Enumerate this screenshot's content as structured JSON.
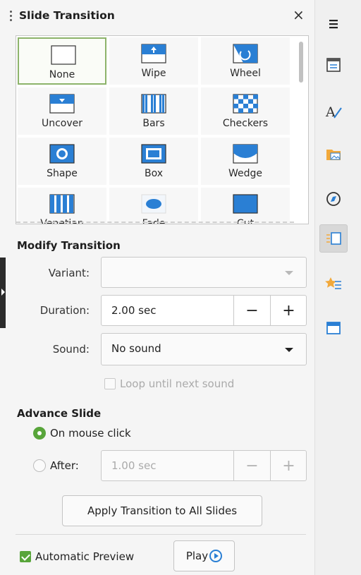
{
  "panel": {
    "title": "Slide Transition",
    "close_label": "×"
  },
  "transitions": [
    {
      "label": "None",
      "icon": "none-icon"
    },
    {
      "label": "Wipe",
      "icon": "wipe-icon"
    },
    {
      "label": "Wheel",
      "icon": "wheel-icon"
    },
    {
      "label": "Uncover",
      "icon": "uncover-icon"
    },
    {
      "label": "Bars",
      "icon": "bars-icon"
    },
    {
      "label": "Checkers",
      "icon": "checkers-icon"
    },
    {
      "label": "Shape",
      "icon": "shape-icon"
    },
    {
      "label": "Box",
      "icon": "box-icon"
    },
    {
      "label": "Wedge",
      "icon": "wedge-icon"
    },
    {
      "label": "Venetian",
      "icon": "venetian-icon"
    },
    {
      "label": "Fade",
      "icon": "fade-icon"
    },
    {
      "label": "Cut",
      "icon": "cut-icon"
    }
  ],
  "selected_transition": "None",
  "modify": {
    "title": "Modify Transition",
    "variant_label": "Variant:",
    "variant_value": "",
    "duration_label": "Duration:",
    "duration_value": "2.00 sec",
    "minus": "−",
    "plus": "+",
    "sound_label": "Sound:",
    "sound_value": "No sound",
    "loop_label": "Loop until next sound"
  },
  "advance": {
    "title": "Advance Slide",
    "on_click_label": "On mouse click",
    "after_label": "After:",
    "after_value": "1.00 sec",
    "minus": "−",
    "plus": "+"
  },
  "apply_all_label": "Apply Transition to All Slides",
  "auto_preview_label": "Automatic Preview",
  "play_label": "Play",
  "colors": {
    "accent_green": "#58a53a",
    "icon_blue": "#2a7fd4"
  },
  "sidebar": [
    "menu-icon",
    "properties-icon",
    "styles-icon",
    "gallery-icon",
    "navigator-icon",
    "slide-transition-icon",
    "animation-icon",
    "master-slides-icon"
  ]
}
